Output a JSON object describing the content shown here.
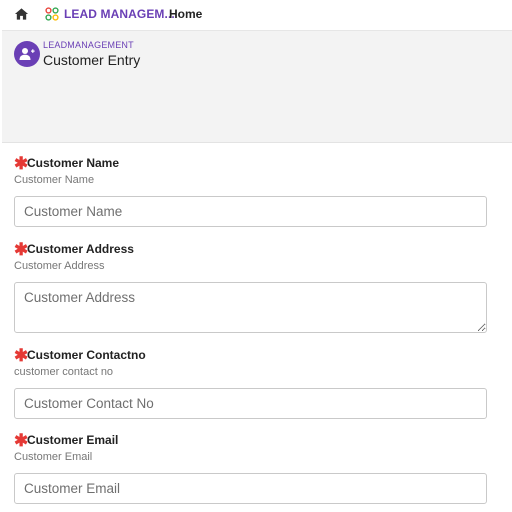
{
  "topbar": {
    "app_title": "LEAD MANAGEM...",
    "home_link": "Home"
  },
  "header": {
    "module_label": "LEADMANAGEMENT",
    "page_title": "Customer Entry"
  },
  "fields": [
    {
      "label": "Customer Name",
      "hint": "Customer Name",
      "placeholder": "Customer Name",
      "required": true
    },
    {
      "label": "Customer Address",
      "hint": "Customer Address",
      "placeholder": "Customer Address",
      "required": true
    },
    {
      "label": "Customer Contactno",
      "hint": "customer contact no",
      "placeholder": "Customer Contact No",
      "required": true
    },
    {
      "label": "Customer Email",
      "hint": "Customer Email",
      "placeholder": "Customer Email",
      "required": true
    }
  ],
  "colors": {
    "brand": "#6a3fb5",
    "required": "#e53935",
    "header_bg": "#f3f3f3"
  },
  "icons": {
    "home": "home-icon",
    "app": "app-grid-icon",
    "avatar": "add-person-icon"
  }
}
